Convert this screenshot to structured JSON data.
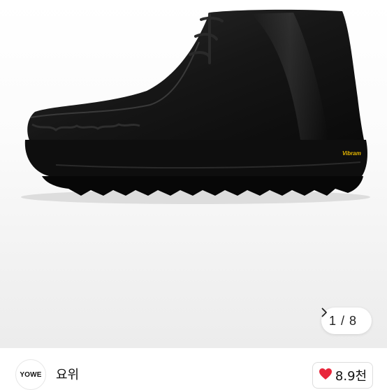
{
  "gallery": {
    "current": "1",
    "separator": "/",
    "total": "8",
    "counter_text": "1 / 8",
    "next_icon": "chevron-right-icon"
  },
  "product_image": {
    "sole_brand_text": "Vibram",
    "colors": {
      "leather": "#151515",
      "sole": "#0d0d0d",
      "brand_mark": "#e8b800"
    }
  },
  "store": {
    "logo_text": "YOWE",
    "name": "요위"
  },
  "like": {
    "icon": "heart-icon",
    "count": "8.9천",
    "heart_color": "#e8263b"
  }
}
